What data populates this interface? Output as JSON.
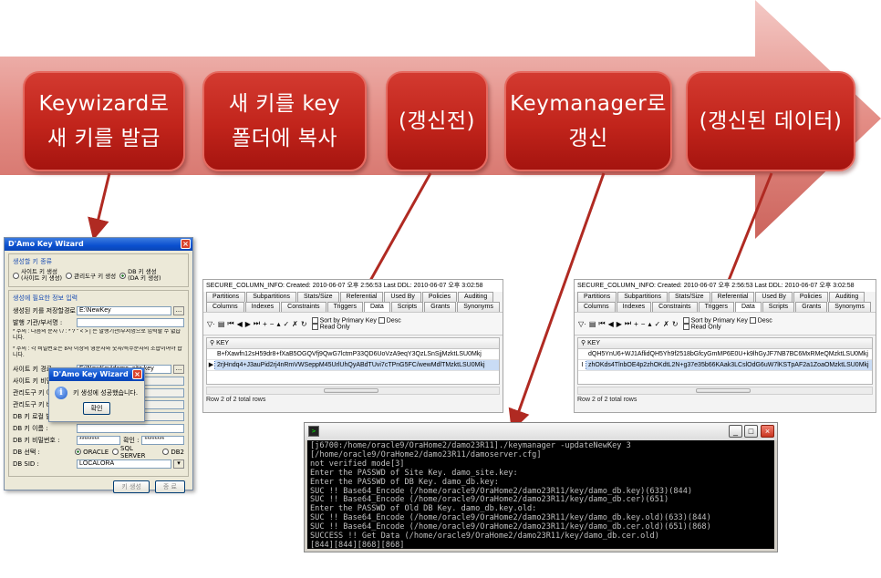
{
  "steps": [
    {
      "line1": "Keywizard로",
      "line2": "새 키를 발급"
    },
    {
      "line1": "새 키를 key",
      "line2": "폴더에 복사"
    },
    {
      "line1": "(갱신전)",
      "line2": ""
    },
    {
      "line1": "Keymanager로",
      "line2": "갱신"
    },
    {
      "line1": "(갱신된 데이터)",
      "line2": ""
    }
  ],
  "colors": {
    "arrow": "#e58f88",
    "step": "#c1241b",
    "connector": "#b02a22"
  },
  "wizard": {
    "title": "D'Amo Key Wizard",
    "group1_title": "생성할 키 종류",
    "radio_site": "사이트 키 생성",
    "radio_site_sub": "(사이트 키 생성)",
    "radio_admin": "관리도구 키 생성",
    "radio_db": "DB 키 생성",
    "radio_db_sub": "(DA 키 생성)",
    "group2_title": "생성에 필요한 정보 입력",
    "row_path_label": "생성된 키를 저장할경로 :",
    "row_path_value": "E:\\NewKey",
    "row_period_label": "발행 기관/부서명 :",
    "note1": "* 주의 : 다음의 문자 \\ / : * ? \" < > | 는 발행기관/부서명으로 입력할 수 없습니다.",
    "note2": "* 주의 : 각 비밀번호는 8자 이상의 영문자와 숫자/특수문자의 조합이어야 합니다.",
    "row_site_key_label": "사이트 키 경로 :",
    "row_site_key_value": "E:\\NewKey\\damo_site.key",
    "row_site_pw_label": "사이트 키 비밀",
    "row_admin_label": "관리도구 키 이름",
    "row_admin_pw_label": "관리도구 키 비",
    "row_dbkey_label": "DB 키 로컬 발",
    "row_dbname_label": "DB 키 이름 :",
    "row_dbname_value": "",
    "row_dbpw_label": "DB 키 비밀번호 :",
    "row_dbpw_value": "********",
    "row_confirm_label": "확인 :",
    "row_confirm_value": "********",
    "row_dbsel_label": "DB 선택 :",
    "db_opt1": "ORACLE",
    "db_opt2": "SQL SERVER",
    "db_opt3": "DB2",
    "row_sid_label": "DB SID :",
    "row_sid_value": "LOCALORA",
    "btn_create": "키 생성",
    "btn_exit": "종 료"
  },
  "popup": {
    "title": "D'Amo Key Wizard",
    "message": "키 생성에 성공했습니다.",
    "ok": "확인"
  },
  "db_before": {
    "info": "SECURE_COLUMN_INFO:  Created: 2010-06-07 오후 2:56:53  Last DDL: 2010-06-07 오후 3:02:58",
    "tabs_top": [
      "Partitions",
      "Subpartitions",
      "Stats/Size",
      "Referential",
      "Used By",
      "Policies",
      "Auditing"
    ],
    "tabs_bottom": [
      "Columns",
      "Indexes",
      "Constraints",
      "Triggers",
      "Data",
      "Scripts",
      "Grants",
      "Synonyms"
    ],
    "sort_label": "Sort by Primary Key",
    "desc_label": "Desc",
    "readonly_label": "Read Only",
    "col_header": "KEY",
    "rows": [
      {
        "ind": "",
        "val": "B+fXawfn12sH59dr8+fXaB5OGQVfj9QwG7lctmP33QD6UoVzA9eqY3QzLSnSjjMzktLSU0Mkj"
      },
      {
        "ind": "▶",
        "val": "2rjHndq4+J3auPid2rj4nRmVWSeppM45UrlUhQyABdTUvi7cTPnG5FC/wewMdlTMzktLSU0Mkj"
      }
    ],
    "status": "Row 2 of 2 total rows"
  },
  "db_after": {
    "info": "SECURE_COLUMN_INFO:  Created: 2010-06-07 오후 2:56:53  Last DDL: 2010-06-07 오후 3:02:58",
    "tabs_top": [
      "Partitions",
      "Subpartitions",
      "Stats/Size",
      "Referential",
      "Used By",
      "Policies",
      "Auditing"
    ],
    "tabs_bottom": [
      "Columns",
      "Indexes",
      "Constraints",
      "Triggers",
      "Data",
      "Scripts",
      "Grants",
      "Synonyms"
    ],
    "sort_label": "Sort by Primary Key",
    "desc_label": "Desc",
    "readonly_label": "Read Only",
    "col_header": "KEY",
    "rows": [
      {
        "ind": "",
        "val": "dQH5YnU6+WJ1AflidQH5Yh9f2518bGfcyGmMP6E0U+k9lhGyJF7NB7BC6MxRMeQMzktLSU0Mkj"
      },
      {
        "ind": "I",
        "val": "zhOKds4TlnbOE4p2zhOKdtL2N+g37e35b66KAak3LCslOdG6uW7lKSTpAF2a1ZoaOMzktLSU0Mkj"
      }
    ],
    "status": "Row 2 of 2 total rows"
  },
  "terminal": {
    "lines": [
      "[j6700:/home/oracle9/OraHome2/damo23R11]./keymanager -updateNewKey 3",
      "[/home/oracle9/OraHome2/damo23R11/damoserver.cfg]",
      "not verified mode[3]",
      "Enter the PASSWD of Site Key. damo_site.key:",
      "Enter the PASSWD of DB Key. damo_db.key:",
      "SUC !! Base64_Encode (/home/oracle9/OraHome2/damo23R11/key/damo_db.key)(633)(844)",
      "SUC !! Base64_Encode (/home/oracle9/OraHome2/damo23R11/key/damo_db.cer)(651)",
      "Enter the PASSWD of Old DB Key. damo_db.key.old:",
      "SUC !! Base64_Encode (/home/oracle9/OraHome2/damo23R11/key/damo_db.key.old)(633)(844)",
      "SUC !! Base64_Encode (/home/oracle9/OraHome2/damo23R11/key/damo_db.cer.old)(651)(868)",
      "SUCCESS !! Get Data (/home/oracle9/OraHome2/damo23R11/key/damo_db.cer.old)",
      "[844][844][868][868]"
    ]
  }
}
